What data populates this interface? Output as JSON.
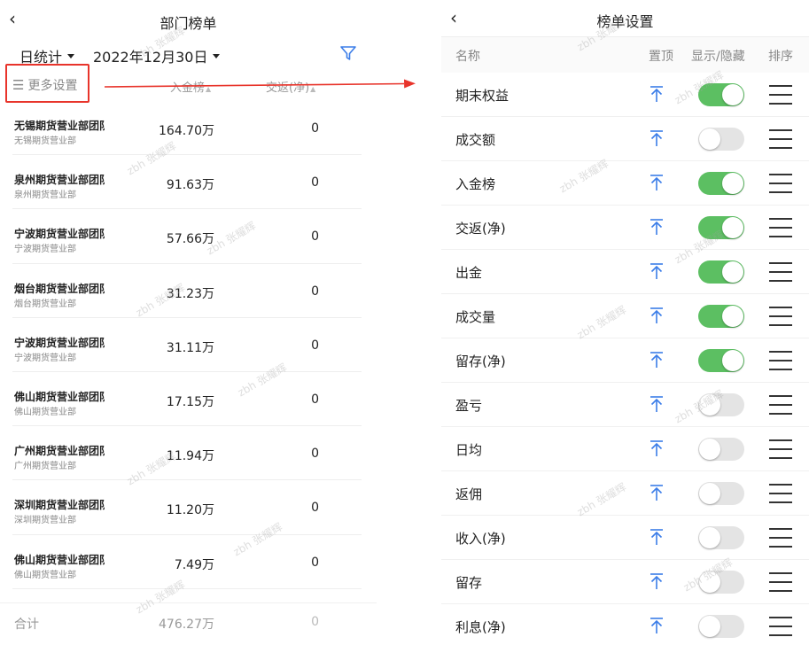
{
  "left": {
    "title": "部门榜单",
    "back_icon": "chevron-left-icon",
    "period_select": "日统计",
    "date_select": "2022年12月30日",
    "filter_icon": "filter-icon",
    "more_settings": "更多设置",
    "col_headers": [
      "入金榜",
      "交返(净)"
    ],
    "rows": [
      {
        "name": "无锡期货营业部团队",
        "sub": "无锡期货营业部",
        "v1": "164.70万",
        "v2": "0"
      },
      {
        "name": "泉州期货营业部团队",
        "sub": "泉州期货营业部",
        "v1": "91.63万",
        "v2": "0"
      },
      {
        "name": "宁波期货营业部团队",
        "sub": "宁波期货营业部",
        "v1": "57.66万",
        "v2": "0"
      },
      {
        "name": "烟台期货营业部团队",
        "sub": "烟台期货营业部",
        "v1": "31.23万",
        "v2": "0"
      },
      {
        "name": "宁波期货营业部团队",
        "sub": "宁波期货营业部",
        "v1": "31.11万",
        "v2": "0"
      },
      {
        "name": "佛山期货营业部团队",
        "sub": "佛山期货营业部",
        "v1": "17.15万",
        "v2": "0"
      },
      {
        "name": "广州期货营业部团队",
        "sub": "广州期货营业部",
        "v1": "11.94万",
        "v2": "0"
      },
      {
        "name": "深圳期货营业部团队",
        "sub": "深圳期货营业部",
        "v1": "11.20万",
        "v2": "0"
      },
      {
        "name": "佛山期货营业部团队",
        "sub": "佛山期货营业部",
        "v1": "7.49万",
        "v2": "0"
      }
    ],
    "total": {
      "label": "合计",
      "v1": "476.27万",
      "v2": "0"
    }
  },
  "right": {
    "title": "榜单设置",
    "back_icon": "chevron-left-icon",
    "col_headers": {
      "name": "名称",
      "pin": "置顶",
      "toggle": "显示/隐藏",
      "sort": "排序"
    },
    "items": [
      {
        "label": "期末权益",
        "on": true
      },
      {
        "label": "成交额",
        "on": false
      },
      {
        "label": "入金榜",
        "on": true
      },
      {
        "label": "交返(净)",
        "on": true
      },
      {
        "label": "出金",
        "on": true
      },
      {
        "label": "成交量",
        "on": true
      },
      {
        "label": "留存(净)",
        "on": true
      },
      {
        "label": "盈亏",
        "on": false
      },
      {
        "label": "日均",
        "on": false
      },
      {
        "label": "返佣",
        "on": false
      },
      {
        "label": "收入(净)",
        "on": false
      },
      {
        "label": "留存",
        "on": false
      },
      {
        "label": "利息(净)",
        "on": false
      }
    ]
  },
  "watermark": "zbh 张耀辉",
  "colors": {
    "accent": "#3b7de8",
    "toggle_on": "#5cbf62",
    "highlight_border": "#e8342b"
  }
}
